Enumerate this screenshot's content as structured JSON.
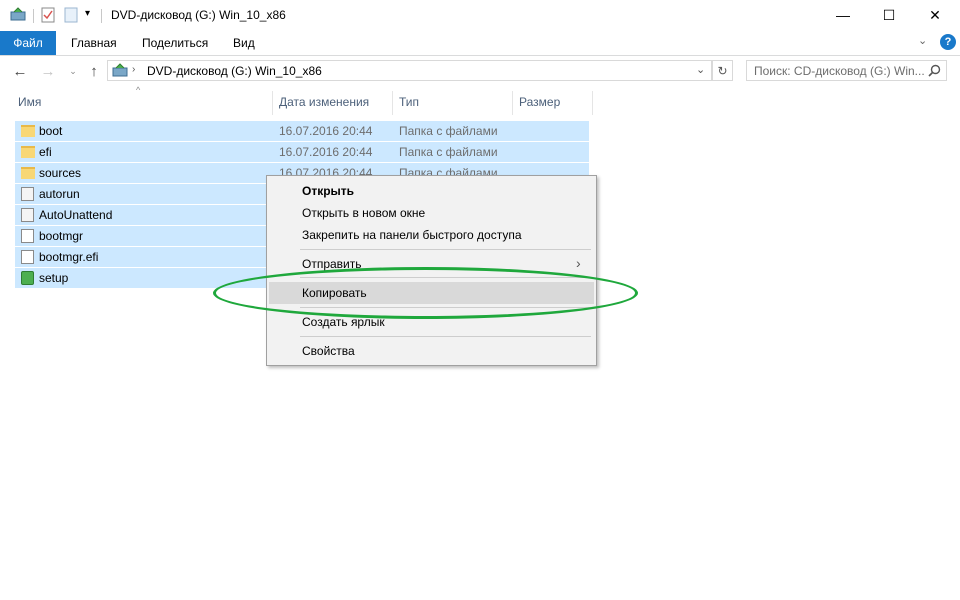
{
  "window": {
    "title": "DVD-дисковод (G:) Win_10_x86",
    "controls": {
      "minimize": "—",
      "maximize": "☐",
      "close": "✕"
    }
  },
  "ribbon": {
    "tabs": [
      "Файл",
      "Главная",
      "Поделиться",
      "Вид"
    ],
    "help": "?"
  },
  "address": {
    "path": "DVD-дисковод (G:) Win_10_x86",
    "search_placeholder": "Поиск: CD-дисковод (G:) Win..."
  },
  "columns": {
    "name": "Имя",
    "date": "Дата изменения",
    "type": "Тип",
    "size": "Размер"
  },
  "files": [
    {
      "name": "boot",
      "date": "16.07.2016 20:44",
      "type": "Папка с файлами",
      "icon": "folder-icon"
    },
    {
      "name": "efi",
      "date": "16.07.2016 20:44",
      "type": "Папка с файлами",
      "icon": "folder-icon"
    },
    {
      "name": "sources",
      "date": "16.07.2016 20:44",
      "type": "Папка с файлами",
      "icon": "folder-icon"
    },
    {
      "name": "autorun",
      "date": "",
      "type": "",
      "icon": "settings-file-icon"
    },
    {
      "name": "AutoUnattend",
      "date": "",
      "type": "",
      "icon": "xml-file-icon"
    },
    {
      "name": "bootmgr",
      "date": "",
      "type": "",
      "icon": "file-icon"
    },
    {
      "name": "bootmgr.efi",
      "date": "",
      "type": "",
      "icon": "file-icon"
    },
    {
      "name": "setup",
      "date": "",
      "type": "",
      "icon": "setup-icon"
    }
  ],
  "context_menu": {
    "open": "Открыть",
    "open_new_window": "Открыть в новом окне",
    "pin_quick_access": "Закрепить на панели быстрого доступа",
    "send_to": "Отправить",
    "copy": "Копировать",
    "create_shortcut": "Создать ярлык",
    "properties": "Свойства"
  },
  "colors": {
    "file_tab": "#1979ca",
    "selection": "#cce8ff",
    "highlight_ellipse": "#1fa83c"
  }
}
